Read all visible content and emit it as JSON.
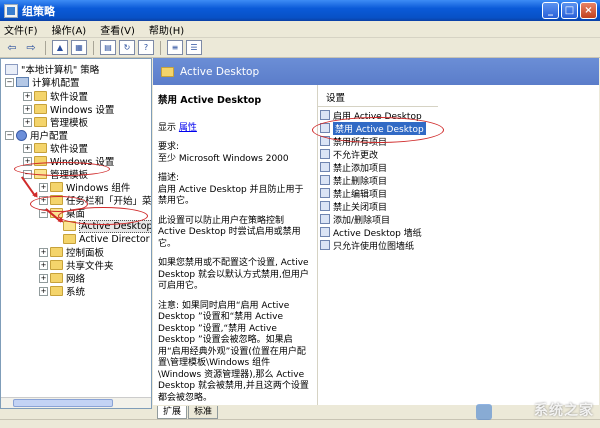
{
  "window": {
    "title": "组策略",
    "btn_min": "_",
    "btn_max": "□",
    "btn_close": "×"
  },
  "menu": [
    "文件(F)",
    "操作(A)",
    "查看(V)",
    "帮助(H)"
  ],
  "toolbar": {
    "icons": [
      "back-icon",
      "forward-icon",
      "up-folder-icon",
      "show-tree-icon",
      "properties-icon",
      "refresh-icon",
      "help-icon",
      "details-view-icon",
      "list-view-icon"
    ]
  },
  "tree": {
    "root": "\"本地计算机\" 策略",
    "computer": "计算机配置",
    "computer_children": [
      "软件设置",
      "Windows 设置",
      "管理模板"
    ],
    "user": "用户配置",
    "user_children": [
      "软件设置",
      "Windows 设置",
      "管理模板"
    ],
    "admin_children": [
      "Windows 组件",
      "任务栏和「开始」菜",
      "桌面"
    ],
    "desktop_children": [
      "Active Desktop",
      "Active Director"
    ],
    "admin_tail": [
      "控制面板",
      "共享文件夹",
      "网络",
      "系统"
    ]
  },
  "header": {
    "title": "Active Desktop"
  },
  "description": {
    "policy_title": "禁用 Active Desktop",
    "show_label": "显示",
    "properties_link": "属性",
    "requirements": "要求:\n至少 Microsoft Windows 2000",
    "desc": "描述:\n启用 Active Desktop 并且防止用于禁用它。",
    "p1": "此设置可以防止用户在策略控制 Active Desktop 时尝试启用或禁用它。",
    "p2": "如果您禁用或不配置这个设置, Active Desktop 就会以默认方式禁用,但用户可启用它。",
    "p3": "注意: 如果同时启用“启用 Active Desktop ”设置和“禁用 Active Desktop ”设置,“禁用 Active Desktop ”设置会被忽略。如果启用“启用经典外观”设置(位置在用户配置\\管理模板\\Windows 组件\\Windows 资源管理器),那么 Active Desktop 就会被禁用,并且这两个设置都会被忽略。"
  },
  "list": {
    "column_header": "设置",
    "items": [
      "启用 Active Desktop",
      "禁用 Active Desktop",
      "禁用所有项目",
      "不允许更改",
      "禁止添加项目",
      "禁止删除项目",
      "禁止编辑项目",
      "禁止关闭项目",
      "添加/删除项目",
      "Active Desktop 墙纸",
      "只允许使用位图墙纸"
    ],
    "selected": "禁用 Active Desktop"
  },
  "tabs": [
    "扩展",
    "标准"
  ],
  "watermark": "系统之家",
  "colors": {
    "title_bar": "#0a5ad8",
    "selection": "#316ac5",
    "annotation": "#d02a2a"
  }
}
